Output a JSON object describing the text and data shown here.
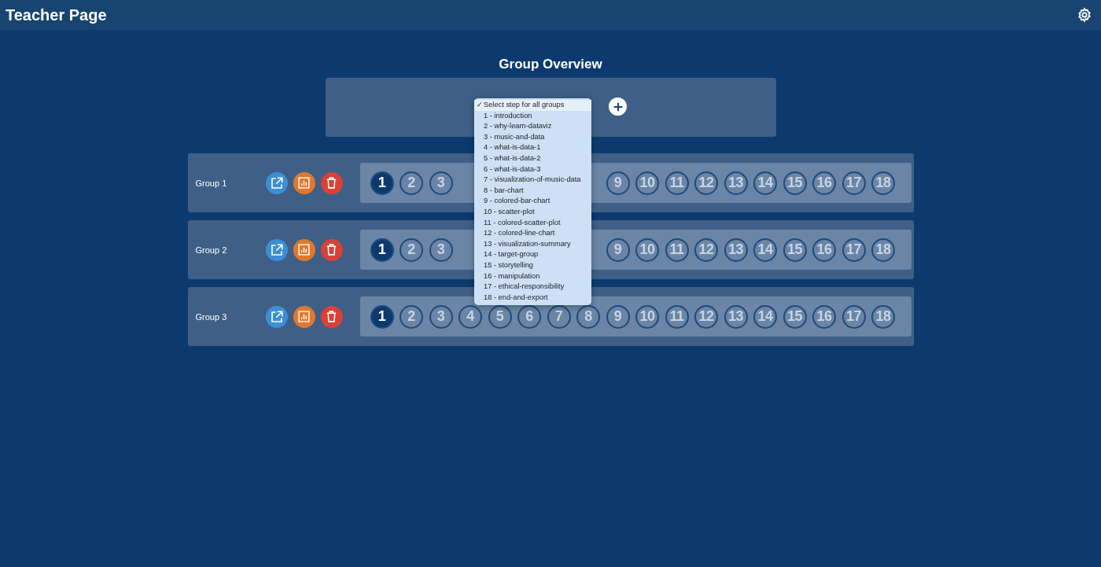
{
  "header": {
    "title": "Teacher Page"
  },
  "overview": {
    "title": "Group Overview",
    "step_menu": [
      {
        "mark": "✓",
        "label": "Select step for all groups",
        "selected": true
      },
      {
        "label": "1 - introduction",
        "selected": false
      },
      {
        "label": "2 - why-learn-dataviz",
        "selected": false
      },
      {
        "label": "3 - music-and-data",
        "selected": false
      },
      {
        "label": "4 - what-is-data-1",
        "selected": false
      },
      {
        "label": "5 - what-is-data-2",
        "selected": false
      },
      {
        "label": "6 - what-is-data-3",
        "selected": false
      },
      {
        "label": "7 - visualization-of-music-data",
        "selected": false
      },
      {
        "label": "8 - bar-chart",
        "selected": false
      },
      {
        "label": "9 - colored-bar-chart",
        "selected": false
      },
      {
        "label": "10 - scatter-plot",
        "selected": false
      },
      {
        "label": "11 - colored-scatter-plot",
        "selected": false
      },
      {
        "label": "12 - colored-line-chart",
        "selected": false
      },
      {
        "label": "13 - visualization-summary",
        "selected": false
      },
      {
        "label": "14 - target-group",
        "selected": false
      },
      {
        "label": "15 - storytelling",
        "selected": false
      },
      {
        "label": "16 - manipulation",
        "selected": false
      },
      {
        "label": "17 - ethical-responsibility",
        "selected": false
      },
      {
        "label": "18 - end-and-export",
        "selected": false
      }
    ]
  },
  "groups": [
    {
      "name": "Group 1",
      "steps": [
        {
          "label": "1",
          "selected": true
        },
        {
          "label": "2",
          "selected": false
        },
        {
          "label": "3",
          "selected": false
        }
      ],
      "steps_after_menu": [
        {
          "label": "9",
          "selected": false
        },
        {
          "label": "10",
          "selected": false
        },
        {
          "label": "11",
          "selected": false
        },
        {
          "label": "12",
          "selected": false
        },
        {
          "label": "13",
          "selected": false
        },
        {
          "label": "14",
          "selected": false
        },
        {
          "label": "15",
          "selected": false
        },
        {
          "label": "16",
          "selected": false
        },
        {
          "label": "17",
          "selected": false
        },
        {
          "label": "18",
          "selected": false
        }
      ]
    },
    {
      "name": "Group 2",
      "steps": [
        {
          "label": "1",
          "selected": true
        },
        {
          "label": "2",
          "selected": false
        },
        {
          "label": "3",
          "selected": false
        }
      ],
      "steps_after_menu": [
        {
          "label": "9",
          "selected": false
        },
        {
          "label": "10",
          "selected": false
        },
        {
          "label": "11",
          "selected": false
        },
        {
          "label": "12",
          "selected": false
        },
        {
          "label": "13",
          "selected": false
        },
        {
          "label": "14",
          "selected": false
        },
        {
          "label": "15",
          "selected": false
        },
        {
          "label": "16",
          "selected": false
        },
        {
          "label": "17",
          "selected": false
        },
        {
          "label": "18",
          "selected": false
        }
      ]
    },
    {
      "name": "Group 3",
      "steps": [
        {
          "label": "1",
          "selected": true
        },
        {
          "label": "2",
          "selected": false
        },
        {
          "label": "3",
          "selected": false
        },
        {
          "label": "4",
          "selected": false
        },
        {
          "label": "5",
          "selected": false
        },
        {
          "label": "6",
          "selected": false
        },
        {
          "label": "7",
          "selected": false
        },
        {
          "label": "8",
          "selected": false
        },
        {
          "label": "9",
          "selected": false
        },
        {
          "label": "10",
          "selected": false
        },
        {
          "label": "11",
          "selected": false
        },
        {
          "label": "12",
          "selected": false
        },
        {
          "label": "13",
          "selected": false
        },
        {
          "label": "14",
          "selected": false
        },
        {
          "label": "15",
          "selected": false
        },
        {
          "label": "16",
          "selected": false
        },
        {
          "label": "17",
          "selected": false
        },
        {
          "label": "18",
          "selected": false
        }
      ]
    }
  ]
}
